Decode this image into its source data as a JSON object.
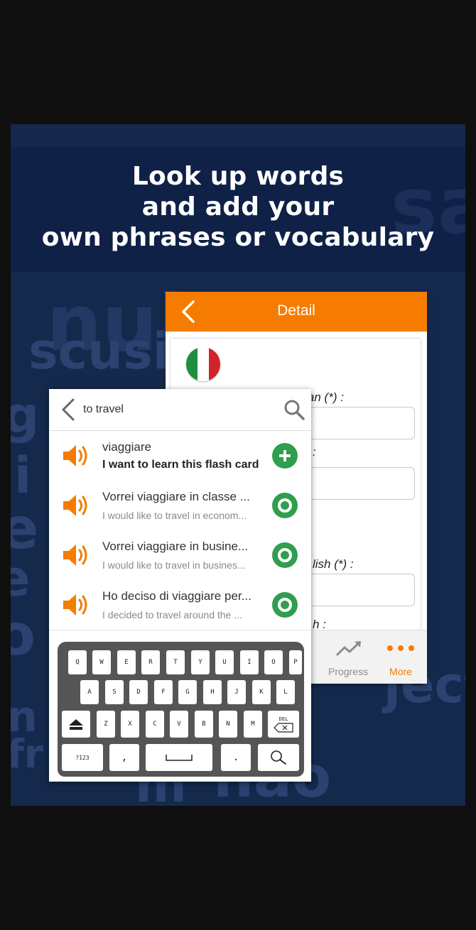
{
  "headline": {
    "lines": [
      "Look up words",
      "and add your",
      "own phrases or vocabulary"
    ]
  },
  "background_words": [
    "sar",
    "nul",
    "scusi",
    "g",
    "i",
    "e",
    "e",
    "o",
    "n",
    "fr",
    "jector",
    "m",
    "não"
  ],
  "detail": {
    "title": "Detail",
    "field1_label": "Word / sentence in Italian (*) :",
    "field2_label": ":",
    "field3_label": "lish (*) :",
    "field4_label": "h :",
    "nav": [
      {
        "label": "Progress",
        "icon": "trend-up-icon"
      },
      {
        "label": "More",
        "icon": "more-dots-icon"
      }
    ]
  },
  "search": {
    "query": "to travel",
    "results": [
      {
        "main": "viaggiare",
        "sub": "I want to learn this flash card",
        "action": "add-icon"
      },
      {
        "main": "Vorrei viaggiare in classe ...",
        "sub": "I would like to travel in econom...",
        "action": "select-icon"
      },
      {
        "main": "Vorrei viaggiare in busine...",
        "sub": "I would like to travel in busines...",
        "action": "select-icon"
      },
      {
        "main": "Ho deciso di viaggiare per...",
        "sub": "I decided to travel around the ...",
        "action": "select-icon"
      }
    ]
  },
  "keyboard": {
    "row1": [
      "Q",
      "W",
      "E",
      "R",
      "T",
      "Y",
      "U",
      "I",
      "O",
      "P"
    ],
    "row2": [
      "A",
      "S",
      "D",
      "F",
      "G",
      "H",
      "J",
      "K",
      "L"
    ],
    "row3": [
      "Z",
      "X",
      "C",
      "V",
      "B",
      "N",
      "M"
    ],
    "del": "DEL",
    "numbers": "?123",
    "comma": ",",
    "period": "."
  },
  "colors": {
    "accent": "#f57c00",
    "action_green": "#2f9e4f",
    "promo_bg": "#15294d"
  }
}
